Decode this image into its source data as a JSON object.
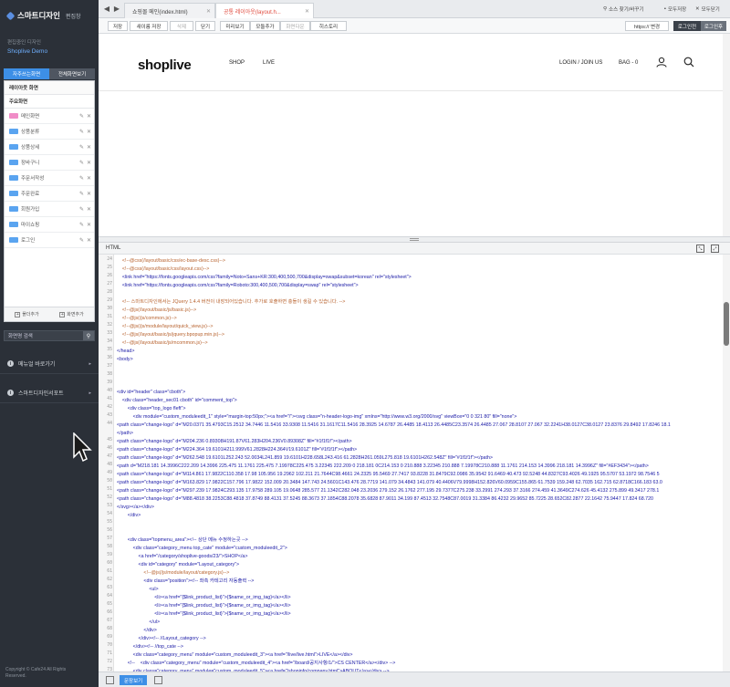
{
  "app": {
    "title": "스마트디자인",
    "subtitle": "편집창"
  },
  "site": {
    "label": "편집중인 디자인",
    "name": "Shoplive Demo"
  },
  "side_tabs": [
    {
      "label": "자주쓰는화면",
      "active": true
    },
    {
      "label": "전체화면보기",
      "active": false
    }
  ],
  "page_list": {
    "layout_title": "레이아웃 화면",
    "main_title": "주요화면",
    "items": [
      {
        "label": "메인화면",
        "color": "pink"
      },
      {
        "label": "상품분류",
        "color": "blue"
      },
      {
        "label": "상품상세",
        "color": "blue"
      },
      {
        "label": "장바구니",
        "color": "blue"
      },
      {
        "label": "주문서작성",
        "color": "blue"
      },
      {
        "label": "주문완료",
        "color": "blue"
      },
      {
        "label": "회원가입",
        "color": "blue"
      },
      {
        "label": "마이쇼핑",
        "color": "blue"
      },
      {
        "label": "로그인",
        "color": "blue"
      }
    ],
    "footer": {
      "add_folder": "폴더추가",
      "add_page": "화면추가"
    }
  },
  "search": {
    "placeholder": "화면명 검색"
  },
  "left_menu": [
    {
      "label": "메뉴얼 바로가기"
    },
    {
      "label": "스마트디자인서포트"
    }
  ],
  "copyright": {
    "line1": "Copyright © Cafe24 All Rights",
    "line2": "Reserved."
  },
  "browser": {
    "nav": [
      "◀",
      "▶"
    ],
    "tabs": [
      {
        "label": "쇼핑몰 메인(index.html)",
        "active": false
      },
      {
        "label": "공통 레이아웃(layout.h...",
        "active": true
      }
    ],
    "top_buttons": [
      "소스 찾기/바꾸기",
      "모두저장",
      "모두닫기"
    ]
  },
  "toolbar": {
    "save": "저장",
    "save_as": "새이름 저장",
    "delete": "삭제",
    "close": "닫기",
    "preview": "미리보기",
    "undo": "모듈추가",
    "redo": "화면다운",
    "history": "히스토리",
    "url_field": "https:// 변경",
    "login_on": "로그인전",
    "login_off": "로그인후"
  },
  "preview": {
    "logo": "shoplive",
    "nav": [
      "SHOP",
      "LIVE"
    ],
    "right_nav": [
      "LOGIN / JOIN US",
      "BAG - 0"
    ]
  },
  "html_panel": {
    "title": "HTML"
  },
  "code_lines": [
    {
      "n": "24",
      "t": "    <!--@css(/layout/basic/css/ec-base-desc.css)-->",
      "c": "cm"
    },
    {
      "n": "25",
      "t": "    <!--@css(/layout/basic/css/layout.css)-->",
      "c": "cm"
    },
    {
      "n": "26",
      "t": "    <link href=\"https://fonts.googleapis.com/css?family=Noto+Sans+KR:300,400,500,700&display=swap&subset=korean\" rel=\"stylesheet\">",
      "c": "tg"
    },
    {
      "n": "27",
      "t": "    <link href=\"https://fonts.googleapis.com/css?family=Roboto:300,400,500,700&display=swap\" rel=\"stylesheet\">",
      "c": "tg"
    },
    {
      "n": "28",
      "t": "",
      "c": "tx"
    },
    {
      "n": "29",
      "t": "    <!-- 스마트디자인에서는 JQuery 1.4.4 버전이 내장되어있습니다. 추가로 호출하면 충돌이 생길 수 있습니다. -->",
      "c": "cm"
    },
    {
      "n": "30",
      "t": "    <!--@js(/layout/basic/js/basic.js)-->",
      "c": "cm"
    },
    {
      "n": "31",
      "t": "    <!--@js(/js/common.js)-->",
      "c": "cm"
    },
    {
      "n": "32",
      "t": "    <!--@js(/js/module/layout/quick_view.js)-->",
      "c": "cm"
    },
    {
      "n": "33",
      "t": "    <!--@js(/layout/basic/js/jquery.bpopup.min.js)-->",
      "c": "cm"
    },
    {
      "n": "34",
      "t": "    <!--@js(/layout/basic/js/mcommon.js)-->",
      "c": "cm"
    },
    {
      "n": "35",
      "t": "</head>",
      "c": "tg"
    },
    {
      "n": "36",
      "t": "<body>",
      "c": "tg"
    },
    {
      "n": "37",
      "t": "",
      "c": "tx"
    },
    {
      "n": "38",
      "t": "",
      "c": "tx"
    },
    {
      "n": "39",
      "t": "",
      "c": "tx"
    },
    {
      "n": "40",
      "t": "<div id=\"header\" class=\"cboth\">",
      "c": "tg"
    },
    {
      "n": "41",
      "t": "    <div class=\"header_sec01 cboth\" id=\"comment_top\">",
      "c": "tg"
    },
    {
      "n": "42",
      "t": "        <div class=\"top_logo fleft\">",
      "c": "tg"
    },
    {
      "n": "43",
      "t": "            <div module=\"custom_moduleedit_1\" style=\"margin-top:50px;\"><a href=\"/\"><svg class=\"n-header-logo-img\" xmlns=\"http://www.w3.org/2000/svg\" viewBox=\"0 0 321 80\" fill=\"none\">",
      "c": "tg"
    },
    {
      "n": "44",
      "t": "<path class=\"change-logo\" d=\"M20.0371 35.4793C15.2512 34.7446 11.5416 33.9308 11.5416 31.1617C11.5416 28.3925 14.6787 26.4485 18.4113 26.4485C23.3574 26.4485 27.067 28.8107 27.067 32.2241H38.0127C38.0127 23.8376 29.8492 17.8246 18.1",
      "c": "tg"
    },
    {
      "n": "",
      "t": "</path>",
      "c": "tg"
    },
    {
      "n": "45",
      "t": "<path class=\"change-logo\" d=\"M204.236 0.89308H191.87V61.283H204.236V0.89308Z\" fill=\"#1f1f1f\"></path>",
      "c": "tg"
    },
    {
      "n": "46",
      "t": "<path class=\"change-logo\" d=\"M224.364 19.6101H211.999V61.2828H224.364V19.6101Z\" fill=\"#1f1f1f\"></path>",
      "c": "tg"
    },
    {
      "n": "47",
      "t": "<path class=\"change-logo\" d=\"M262.548 19.6101L252.243 52.0034L241.859 19.6101H228.658L243.416 61.2828H261.059L275.818 19.6101H262.548Z\" fill=\"#1f1f1f\"></path>",
      "c": "tg"
    },
    {
      "n": "48",
      "t": "<path d=\"M218.181 14.3996C222.209 14.3996 225.475 11.1761 225.475 7.19978C225.475 3.22345 222.209 0 218.181 0C214.153 0 210.888 3.22345 210.888 7.19978C210.888 11.1761 214.153 14.3996 218.181 14.3996Z\" fill=\"#EF3434\"></path>",
      "c": "tg"
    },
    {
      "n": "49",
      "t": "<path class=\"change-logo\" d=\"M114.861 17.9822C110.358 17.98 105.956 19.2962 102.211 21.7644C98.4661 24.2325 95.5469 27.7417 93.8228 31.8479C92.0986 35.9542 91.6469 40.473 92.5248 44.8327C93.4026 49.1925 95.5707 53.1972 98.7546 5",
      "c": "tg"
    },
    {
      "n": "50",
      "t": "<path class=\"change-logo\" d=\"M163.829 17.9822C157.796 17.9822 152.009 20.3484 147.743 24.5601C143.476 28.7719 141.079 34.4843 141.079 40.4406V79.9998H152.826V60.0959C155.865 61.7539 159.248 62.7035 162.715 62.8718C166.183 63.0",
      "c": "tg"
    },
    {
      "n": "51",
      "t": "<path class=\"change-logo\" d=\"M297.239 17.9824C293.135 17.9758 289.105 19.0648 285.577 21.1342C282.048 23.2036 279.152 26.1762 277.195 29.7377C275.238 33.2991 274.293 37.3166 274.459 41.3649C274.626 45.4132 275.899 49.3417 278.1",
      "c": "tg"
    },
    {
      "n": "52",
      "t": "<path class=\"change-logo\" d=\"M88.4818 38.2253C88.4818 37.8749 88.4131 37.5245 88.3673 37.1854C88.2078 35.6828 87.9011 34.199 87.4513 32.7548C87.0019 31.3384 86.4232 29.9652 85.7225 28.652C82.2877 22.1642 75.9447 17.824 68.720",
      "c": "tg"
    },
    {
      "n": "53",
      "t": "</svg></a></div>",
      "c": "tg"
    },
    {
      "n": "54",
      "t": "        </div>",
      "c": "tg"
    },
    {
      "n": "55",
      "t": "",
      "c": "tx"
    },
    {
      "n": "56",
      "t": "",
      "c": "tx"
    },
    {
      "n": "57",
      "t": "        <div class=\"topmenu_area\"><!-- 상단 메뉴 수정하는곳 -->",
      "c": "tg"
    },
    {
      "n": "58",
      "t": "            <div class=\"category_menu top_cate\" module=\"custom_moduleedit_2\">",
      "c": "tg"
    },
    {
      "n": "59",
      "t": "                <a href=\"/category/shoplive-goods/23/\">SHOP</a>",
      "c": "tg"
    },
    {
      "n": "60",
      "t": "                <div id=\"category\" module=\"Layout_category\">",
      "c": "tg"
    },
    {
      "n": "61",
      "t": "                    <!--@js(/js/module/layout/category.js)-->",
      "c": "cm"
    },
    {
      "n": "62",
      "t": "                    <div class=\"position\"><!-- 좌측 카테고리 자동출력 -->",
      "c": "tg"
    },
    {
      "n": "63",
      "t": "                        <ul>",
      "c": "tg"
    },
    {
      "n": "64",
      "t": "                            <li><a href=\"{$link_product_list}\">{$name_or_img_tag}</a></li>",
      "c": "tg"
    },
    {
      "n": "65",
      "t": "                            <li><a href=\"{$link_product_list}\">{$name_or_img_tag}</a></li>",
      "c": "tg"
    },
    {
      "n": "66",
      "t": "                            <li><a href=\"{$link_product_list}\">{$name_or_img_tag}</a></li>",
      "c": "tg"
    },
    {
      "n": "67",
      "t": "                        </ul>",
      "c": "tg"
    },
    {
      "n": "68",
      "t": "                    </div>",
      "c": "tg"
    },
    {
      "n": "69",
      "t": "                </div><!-- //Layout_category -->",
      "c": "tg"
    },
    {
      "n": "70",
      "t": "            </div><!-- //top_cate -->",
      "c": "tg"
    },
    {
      "n": "71",
      "t": "            <div class=\"category_menu\" module=\"custom_moduleedit_3\"><a href=\"/live/live.html\">LIVE</a></div>",
      "c": "tg"
    },
    {
      "n": "72",
      "t": "        <!--    <div class=\"category_menu\" module=\"custom_moduleedit_4\"><a href=\"/board/공지사항/1/\">CS CENTER</a></div> -->",
      "c": "tg"
    },
    {
      "n": "73",
      "t": "            <div class=\"category_menu\" module=\"custom_moduleedit_5\"><a href=\"/shopinfo/company.html\">ABOUT</a></div> -->",
      "c": "tg"
    }
  ],
  "bottom": {
    "source_view": "문장보기"
  }
}
